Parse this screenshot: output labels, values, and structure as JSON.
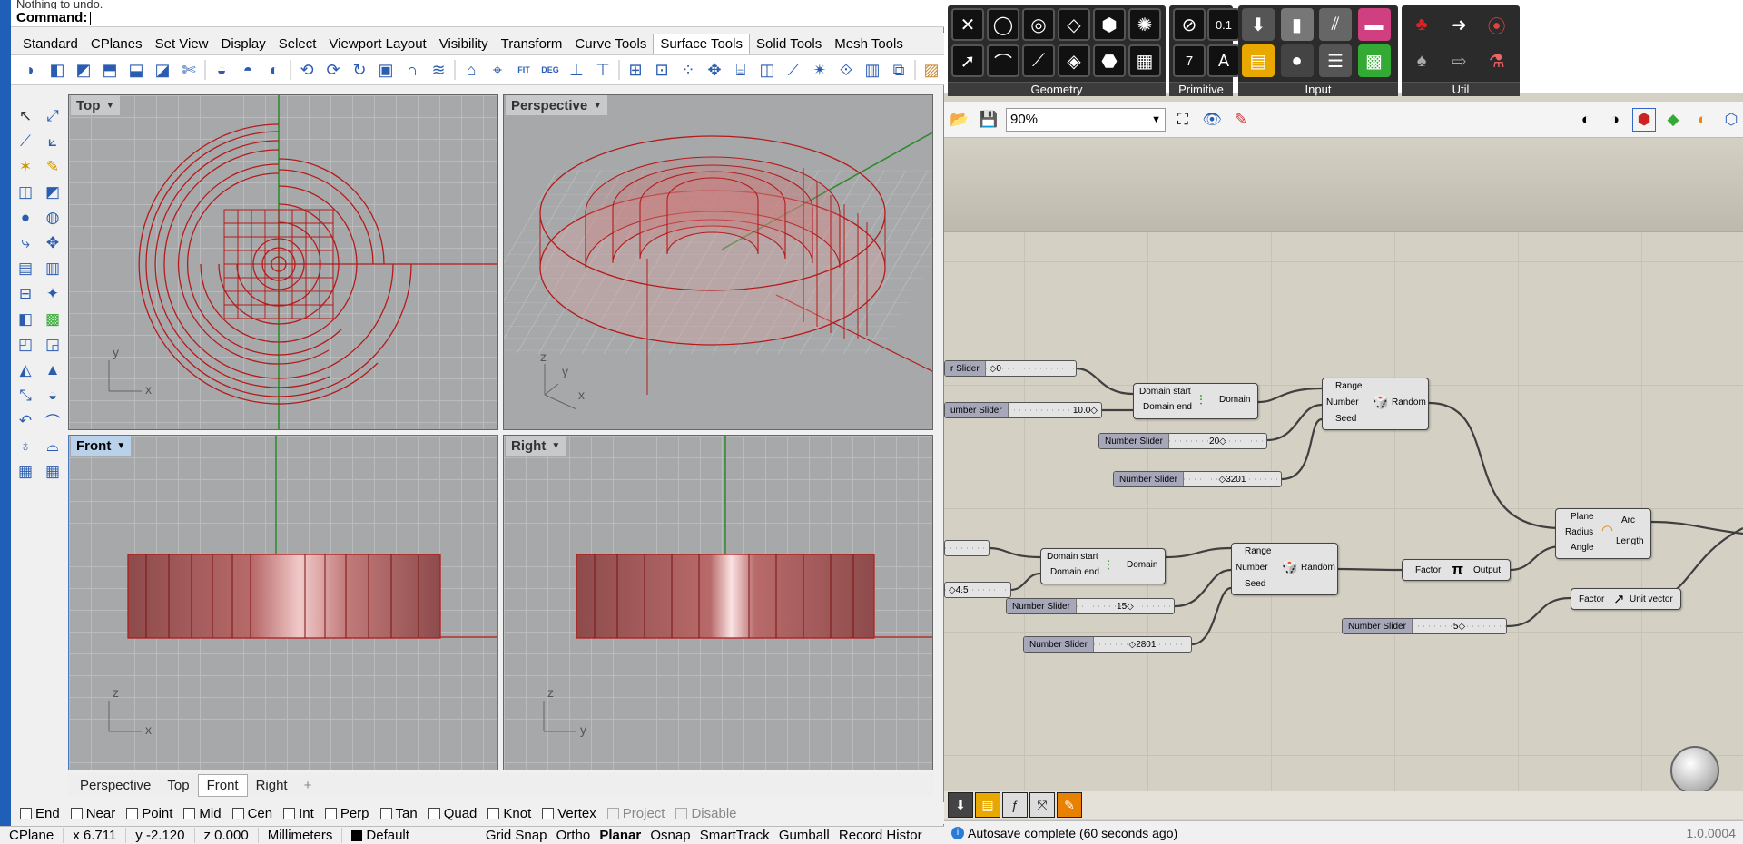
{
  "rhino": {
    "command_history": "Nothing to undo.",
    "command_prompt": "Command:",
    "tabs": [
      {
        "label": "Standard"
      },
      {
        "label": "CPlanes"
      },
      {
        "label": "Set View"
      },
      {
        "label": "Display"
      },
      {
        "label": "Select"
      },
      {
        "label": "Viewport Layout"
      },
      {
        "label": "Visibility"
      },
      {
        "label": "Transform"
      },
      {
        "label": "Curve Tools"
      },
      {
        "label": "Surface Tools",
        "active": true
      },
      {
        "label": "Solid Tools"
      },
      {
        "label": "Mesh Tools"
      }
    ],
    "viewports": {
      "top": {
        "label": "Top",
        "axis_h": "x",
        "axis_v": "y"
      },
      "perspective": {
        "label": "Perspective",
        "axis_h": "x",
        "axis_v": "z",
        "axis_d": "y"
      },
      "front": {
        "label": "Front",
        "axis_h": "x",
        "axis_v": "z",
        "active": true
      },
      "right": {
        "label": "Right",
        "axis_h": "y",
        "axis_v": "z"
      }
    },
    "viewport_tabs": [
      {
        "label": "Perspective"
      },
      {
        "label": "Top"
      },
      {
        "label": "Front",
        "active": true
      },
      {
        "label": "Right"
      }
    ],
    "viewport_tab_add": "+",
    "osnaps": [
      {
        "label": "End"
      },
      {
        "label": "Near"
      },
      {
        "label": "Point"
      },
      {
        "label": "Mid"
      },
      {
        "label": "Cen"
      },
      {
        "label": "Int"
      },
      {
        "label": "Perp"
      },
      {
        "label": "Tan"
      },
      {
        "label": "Quad"
      },
      {
        "label": "Knot"
      },
      {
        "label": "Vertex"
      },
      {
        "label": "Project",
        "disabled": true
      },
      {
        "label": "Disable",
        "disabled": true
      }
    ],
    "status": {
      "cplane": "CPlane",
      "x": "x 6.711",
      "y": "y -2.120",
      "z": "z 0.000",
      "units": "Millimeters",
      "layer": "Default",
      "toggles": [
        {
          "label": "Grid Snap"
        },
        {
          "label": "Ortho"
        },
        {
          "label": "Planar",
          "on": true
        },
        {
          "label": "Osnap"
        },
        {
          "label": "SmartTrack"
        },
        {
          "label": "Gumball"
        },
        {
          "label": "Record Histor"
        }
      ]
    }
  },
  "grasshopper": {
    "panels": [
      {
        "label": "Geometry"
      },
      {
        "label": "Primitive"
      },
      {
        "label": "Input"
      },
      {
        "label": "Util"
      }
    ],
    "zoom": "90%",
    "nodes": {
      "slider_a": {
        "name": "r Slider",
        "value": "0"
      },
      "slider_b": {
        "name": "umber Slider",
        "value": "10.0"
      },
      "slider_c": {
        "name": "Number Slider",
        "value": "20"
      },
      "slider_d": {
        "name": "Number Slider",
        "value": "3201"
      },
      "slider_e": {
        "name": "",
        "value": ""
      },
      "slider_f": {
        "name": "",
        "value": "4.5"
      },
      "slider_g": {
        "name": "Number Slider",
        "value": "15"
      },
      "slider_h": {
        "name": "Number Slider",
        "value": "2801"
      },
      "slider_i": {
        "name": "Number Slider",
        "value": "5"
      },
      "domain1": {
        "in1": "Domain start",
        "in2": "Domain end",
        "out": "Domain"
      },
      "domain2": {
        "in1": "Domain start",
        "in2": "Domain end",
        "out": "Domain"
      },
      "random1": {
        "in1": "Range",
        "in2": "Number",
        "in3": "Seed",
        "out": "Random"
      },
      "random2": {
        "in1": "Range",
        "in2": "Number",
        "in3": "Seed",
        "out": "Random"
      },
      "pi": {
        "in": "Factor",
        "out": "Output"
      },
      "arc": {
        "in1": "Plane",
        "in2": "Radius",
        "in3": "Angle",
        "out1": "Arc",
        "out2": "Length"
      },
      "unitz": {
        "in": "Factor",
        "out": "Unit vector"
      }
    },
    "status_msg": "Autosave complete (60 seconds ago)",
    "version": "1.0.0004"
  },
  "colors": {
    "accent": "#1f5fb8",
    "curve": "#b51b1b",
    "grid": "#a6a8aa",
    "canvas": "#d4d0c4"
  }
}
